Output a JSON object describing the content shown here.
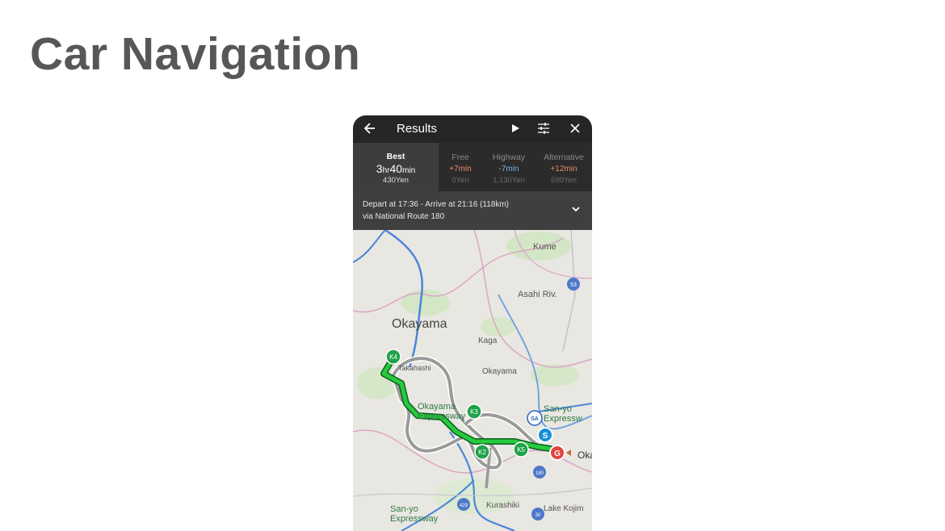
{
  "slide": {
    "title": "Car Navigation"
  },
  "topbar": {
    "title": "Results",
    "back_icon": "arrow-left-icon",
    "play_icon": "play-icon",
    "settings_icon": "sliders-icon",
    "close_icon": "close-icon"
  },
  "tabs": [
    {
      "name": "Best",
      "time_h": "3",
      "time_h_unit": "hr",
      "time_m": "40",
      "time_m_unit": "min",
      "cost": "430Yen",
      "active": true
    },
    {
      "name": "Free",
      "delta": "+7min",
      "cost": "0Yen",
      "delta_color": "#e98a6a"
    },
    {
      "name": "Highway",
      "delta": "-7min",
      "cost": "1,130Yen",
      "delta_color": "#7fb3e0"
    },
    {
      "name": "Alternative",
      "delta": "+12min",
      "cost": "590Yen",
      "delta_color": "#e98a6a"
    }
  ],
  "summary": {
    "line1": "Depart at 17:36 - Arrive at 21:16  (118km)",
    "line2": "via National Route 180",
    "expand_icon": "chevron-down-icon"
  },
  "map": {
    "labels": {
      "kume": "Kume",
      "asahi": "Asahi Riv.",
      "okayama_region": "Okayama",
      "kaga": "Kaga",
      "takahashi": "Takahashi",
      "okayama_town": "Okayama",
      "okayama_expressway": "Okayama\nExpressway",
      "sanyo_expressway_east": "San-yo\nExpressw",
      "sanyo_expressway_west": "San-yo\nExpressway",
      "kurashiki": "Kurashiki",
      "lake_kojima": "Lake Kojim",
      "oka": "Oka"
    },
    "markers": {
      "start": "S",
      "goal": "G",
      "service_area": "SA",
      "k2": "K2",
      "k3": "K3",
      "k4": "K4",
      "k5": "K5"
    },
    "road_numbers": {
      "r53": "53",
      "r180": "180",
      "r429": "429",
      "r30": "30"
    },
    "colors": {
      "route": "#27c93f",
      "alt_route": "#9a9a9a",
      "start": "#1a8fd6",
      "goal": "#e2433b"
    }
  }
}
